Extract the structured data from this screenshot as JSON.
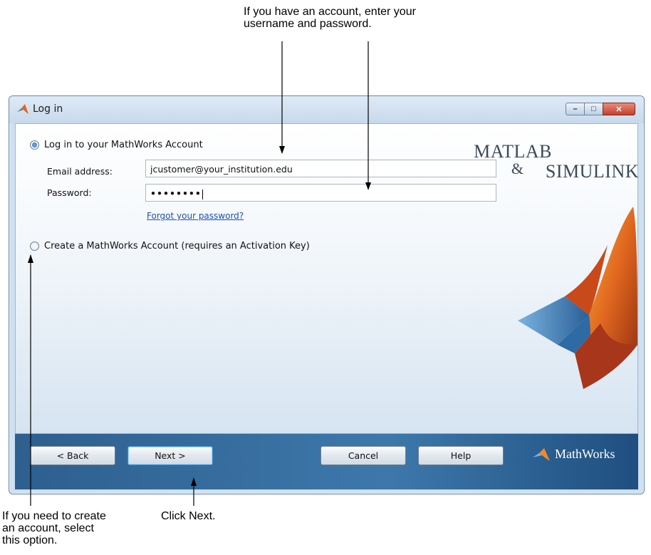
{
  "annotations": {
    "top": "If you have an account, enter your\nusername and password.",
    "left": "If you need to create\nan account, select\nthis option.",
    "next": "Click Next."
  },
  "window": {
    "title": "Log in",
    "controls": {
      "minimize": "–",
      "maximize": "□",
      "close": "✕"
    }
  },
  "login_option": {
    "label": "Log in to your MathWorks Account",
    "selected": true,
    "email_label": "Email address:",
    "email_value": "jcustomer@your_institution.edu",
    "password_label": "Password:",
    "password_value": "••••••••",
    "forgot_link": "Forgot your password?"
  },
  "create_option": {
    "label": "Create a MathWorks Account (requires an Activation Key)",
    "selected": false
  },
  "branding": {
    "matlab": "MATLAB",
    "amp": "&",
    "simulink": "SIMULINK",
    "mathworks": "MathWorks"
  },
  "footer": {
    "back": "< Back",
    "next": "Next >",
    "cancel": "Cancel",
    "help": "Help"
  },
  "icons": [
    "matlab-membrane-icon",
    "minimize-icon",
    "maximize-icon",
    "close-icon",
    "mathworks-logo-icon"
  ],
  "colors": {
    "footer": "#2d5f8f",
    "link": "#1a4fb5",
    "close": "#c3402b"
  }
}
